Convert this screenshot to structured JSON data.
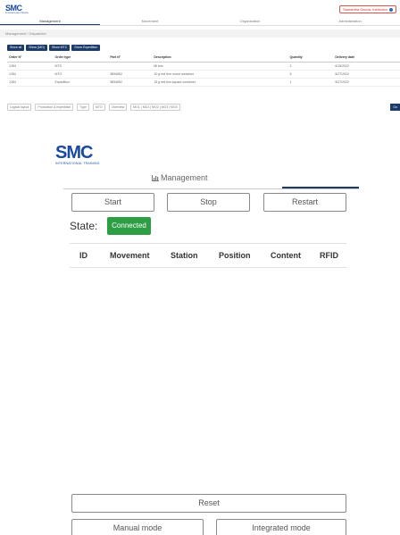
{
  "top": {
    "logo": "SMC",
    "logo_sub": "INTERNATIONAL TRAINING",
    "user": "Samantha Garcia, Instructor",
    "tabs": [
      "Management",
      "Movement",
      "Organization",
      "Administration"
    ],
    "breadcrumb": "Management / Dispatcher",
    "buttons": [
      "Show all",
      "Show (MO)",
      "Show MTC",
      "Show Expedition"
    ],
    "columns": [
      "Order N°",
      "Order type",
      "Part N°",
      "Description",
      "Quantity",
      "Delivery date"
    ],
    "rows": [
      [
        "1284",
        "MTS",
        "",
        "Mi box",
        "2",
        "6/15/2022"
      ],
      [
        "1284",
        "MTO",
        "5894652",
        "10 g red tinn round container",
        "5",
        "5/27/2022"
      ],
      [
        "1284",
        "Expedition",
        "5894652",
        "15 g red tinn square container",
        "1",
        "5/27/2022"
      ]
    ],
    "filters": {
      "logical": "Logical layout",
      "process": "Production & expedition",
      "type_label": "Type",
      "type_value": "MTO",
      "overview": "Overview",
      "overview_value": "MO1 | MO1 | MO2 | MO3 | MO3",
      "go": "Go"
    }
  },
  "main": {
    "logo": "SMC",
    "logo_sub": "INTERNATIONAL TRAINING",
    "tab": "Management",
    "start": "Start",
    "stop": "Stop",
    "restart": "Restart",
    "state_label": "State:",
    "state_value": "Connected",
    "columns": [
      "ID",
      "Movement",
      "Station",
      "Position",
      "Content",
      "RFID"
    ],
    "reset": "Reset",
    "manual_mode": "Manual mode",
    "integrated_mode": "Integrated mode"
  },
  "colors": {
    "brand": "#1a4aa0",
    "nav": "#1c3b6b",
    "connected": "#2e9e44"
  }
}
